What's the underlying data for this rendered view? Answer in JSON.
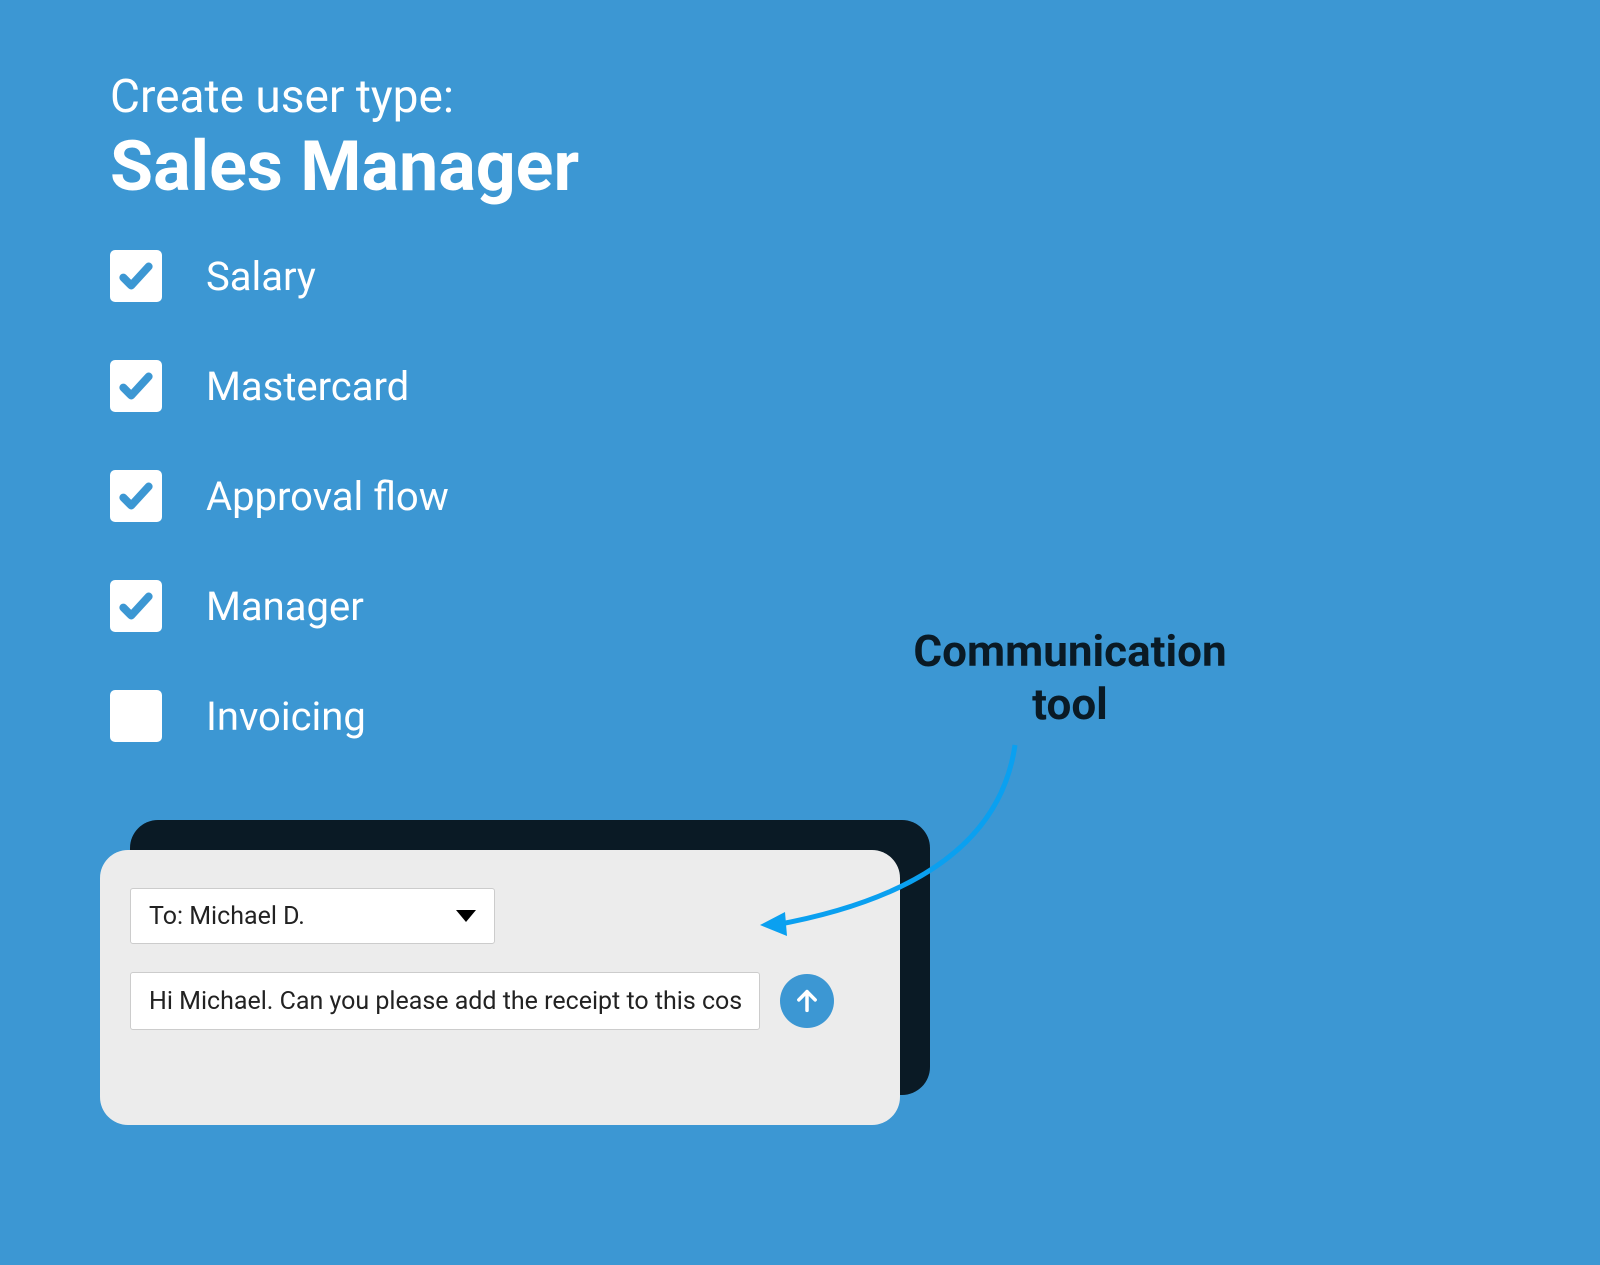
{
  "header": {
    "subtitle": "Create user type:",
    "title": "Sales Manager"
  },
  "checklist": {
    "items": [
      {
        "label": "Salary",
        "checked": true
      },
      {
        "label": "Mastercard",
        "checked": true
      },
      {
        "label": "Approval flow",
        "checked": true
      },
      {
        "label": "Manager",
        "checked": true
      },
      {
        "label": "Invoicing",
        "checked": false
      }
    ]
  },
  "comm_panel": {
    "recipient_prefix": "To: ",
    "recipient_name": "Michael D.",
    "message": "Hi Michael. Can you please add the receipt to this cost."
  },
  "annotation": {
    "text": "Communication tool"
  },
  "colors": {
    "background": "#3c97d3",
    "panel_bg": "#ececec",
    "text_white": "#ffffff",
    "text_dark": "#0a1a25",
    "accent": "#3c97d3"
  }
}
